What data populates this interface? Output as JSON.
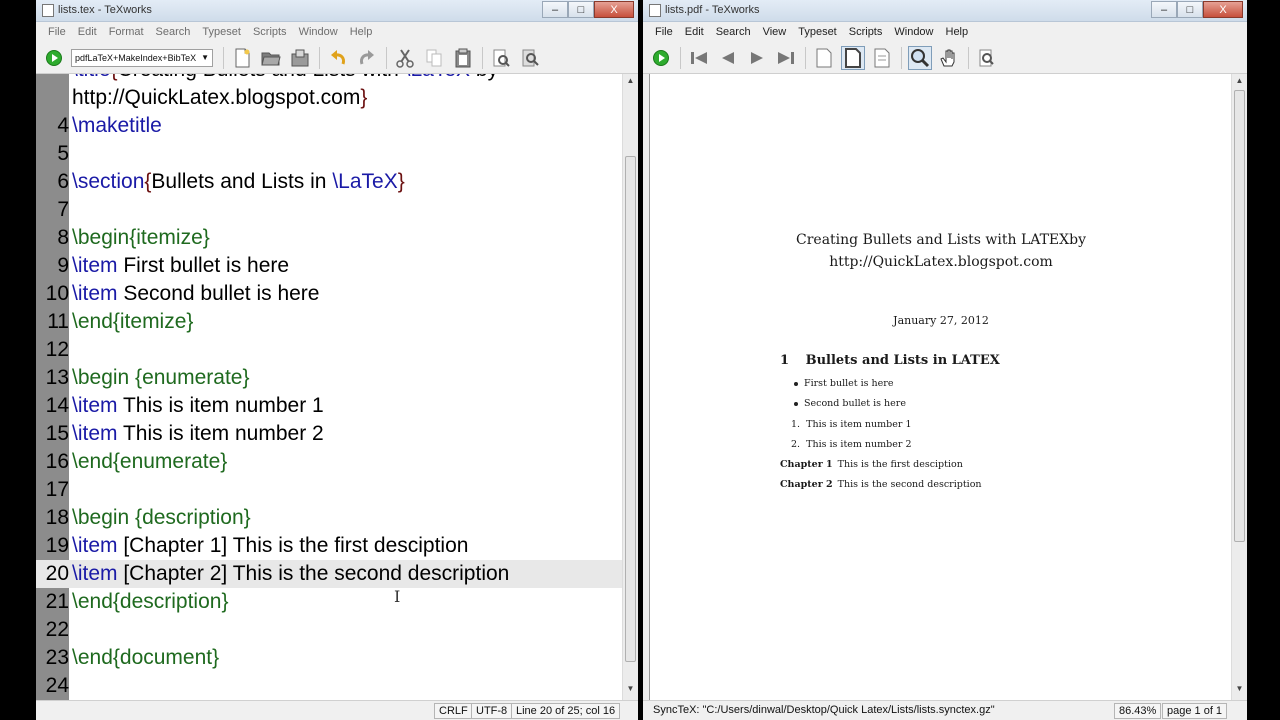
{
  "editor_window": {
    "title": "lists.tex - TeXworks",
    "window_controls": {
      "minimize": "–",
      "maximize": "□",
      "close": "X"
    },
    "menu": [
      "File",
      "Edit",
      "Format",
      "Search",
      "Typeset",
      "Scripts",
      "Window",
      "Help"
    ],
    "typeset_engine": "pdfLaTeX+MakeIndex+BibTeX",
    "status": {
      "line_ending": "CRLF",
      "encoding": "UTF-8",
      "position": "Line 20 of 25; col 16"
    },
    "lines": [
      {
        "num": "",
        "parts": [
          [
            "cmd",
            "\\title"
          ],
          [
            "brace",
            "{"
          ],
          [
            "txt",
            "Creating Bullets and Lists with "
          ],
          [
            "cmd",
            "\\LaTeX"
          ],
          [
            "txt",
            " by"
          ]
        ]
      },
      {
        "num": "",
        "parts": [
          [
            "txt",
            "http://QuickLatex.blogspot.com"
          ],
          [
            "brace",
            "}"
          ]
        ]
      },
      {
        "num": "4",
        "parts": [
          [
            "cmd",
            "\\maketitle"
          ]
        ]
      },
      {
        "num": "5",
        "parts": []
      },
      {
        "num": "6",
        "parts": [
          [
            "cmd",
            "\\section"
          ],
          [
            "brace",
            "{"
          ],
          [
            "txt",
            "Bullets and Lists in "
          ],
          [
            "cmd",
            "\\LaTeX"
          ],
          [
            "brace",
            "}"
          ]
        ]
      },
      {
        "num": "7",
        "parts": []
      },
      {
        "num": "8",
        "parts": [
          [
            "env",
            "\\begin{itemize}"
          ]
        ]
      },
      {
        "num": "9",
        "parts": [
          [
            "cmd",
            "\\item"
          ],
          [
            "txt",
            " First bullet is here"
          ]
        ]
      },
      {
        "num": "10",
        "parts": [
          [
            "cmd",
            "\\item"
          ],
          [
            "txt",
            " Second bullet is here"
          ]
        ]
      },
      {
        "num": "11",
        "parts": [
          [
            "env",
            "\\end{itemize}"
          ]
        ]
      },
      {
        "num": "12",
        "parts": []
      },
      {
        "num": "13",
        "parts": [
          [
            "env",
            "\\begin {enumerate}"
          ]
        ]
      },
      {
        "num": "14",
        "parts": [
          [
            "cmd",
            "\\item"
          ],
          [
            "txt",
            " This is item number 1"
          ]
        ]
      },
      {
        "num": "15",
        "parts": [
          [
            "cmd",
            "\\item"
          ],
          [
            "txt",
            " This is item number 2"
          ]
        ]
      },
      {
        "num": "16",
        "parts": [
          [
            "env",
            "\\end{enumerate}"
          ]
        ]
      },
      {
        "num": "17",
        "parts": []
      },
      {
        "num": "18",
        "parts": [
          [
            "env",
            "\\begin {description}"
          ]
        ]
      },
      {
        "num": "19",
        "parts": [
          [
            "cmd",
            "\\item"
          ],
          [
            "txt",
            " [Chapter 1] This is the first desciption"
          ]
        ]
      },
      {
        "num": "20",
        "parts": [
          [
            "cmd",
            "\\item"
          ],
          [
            "txt",
            " [Chapter 2] This is the second description"
          ]
        ],
        "current": true
      },
      {
        "num": "21",
        "parts": [
          [
            "env",
            "\\end{description}"
          ]
        ]
      },
      {
        "num": "22",
        "parts": []
      },
      {
        "num": "23",
        "parts": [
          [
            "env",
            "\\end{document}"
          ]
        ]
      },
      {
        "num": "24",
        "parts": []
      }
    ],
    "text_cursor": "I"
  },
  "pdf_window": {
    "title": "lists.pdf - TeXworks",
    "window_controls": {
      "minimize": "–",
      "maximize": "□",
      "close": "X"
    },
    "menu": [
      "File",
      "Edit",
      "Search",
      "View",
      "Typeset",
      "Scripts",
      "Window",
      "Help"
    ],
    "status": {
      "synctex": "SyncTeX: \"C:/Users/dinwal/Desktop/Quick Latex/Lists/lists.synctex.gz\"",
      "zoom": "86.43%",
      "page": "page 1 of 1"
    },
    "document": {
      "title_line1": "Creating Bullets and Lists with LATEXby",
      "title_line2": "http://QuickLatex.blogspot.com",
      "date": "January 27, 2012",
      "section_number": "1",
      "section_title": "Bullets and Lists in LATEX",
      "bullets": [
        "First bullet is here",
        "Second bullet is here"
      ],
      "enumerate": [
        {
          "label": "1.",
          "text": "This is item number 1"
        },
        {
          "label": "2.",
          "text": "This is item number 2"
        }
      ],
      "description": [
        {
          "term": "Chapter 1",
          "text": "This is the first desciption"
        },
        {
          "term": "Chapter 2",
          "text": "This is the second description"
        }
      ]
    }
  },
  "colors": {
    "command": "#1a1aa6",
    "environment": "#1f6a1f",
    "brace": "#6b1010",
    "gutter": "#8c8c8c",
    "typeset_green": "#2eab2e"
  }
}
